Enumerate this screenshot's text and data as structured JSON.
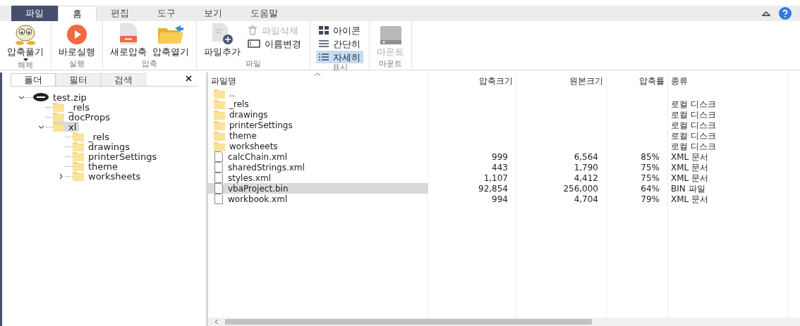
{
  "menu_tabs": [
    {
      "label": "파일",
      "kind": "file",
      "selected": false
    },
    {
      "label": "홈",
      "kind": "tab",
      "selected": true
    },
    {
      "label": "편집",
      "kind": "tab",
      "selected": false
    },
    {
      "label": "도구",
      "kind": "tab",
      "selected": false
    },
    {
      "label": "보기",
      "kind": "tab",
      "selected": false
    },
    {
      "label": "도움말",
      "kind": "tab",
      "selected": false
    }
  ],
  "ribbon": {
    "groups": [
      {
        "label": "해제",
        "items": [
          {
            "label": "압축풀기",
            "kind": "big",
            "dropdown": true,
            "disabled": false
          }
        ]
      },
      {
        "label": "실행",
        "items": [
          {
            "label": "바로실행",
            "kind": "big",
            "disabled": false
          }
        ]
      },
      {
        "label": "압축",
        "items": [
          {
            "label": "새로압축",
            "kind": "big",
            "disabled": false
          },
          {
            "label": "압축열기",
            "kind": "big",
            "disabled": false
          }
        ]
      },
      {
        "label": "파일",
        "items": [
          {
            "label": "파일추가",
            "kind": "big",
            "disabled": false
          },
          {
            "label": "파일삭제",
            "kind": "small",
            "disabled": true
          },
          {
            "label": "이름변경",
            "kind": "small",
            "disabled": false
          }
        ]
      },
      {
        "label": "표시",
        "items": [
          {
            "label": "아이콘",
            "kind": "view",
            "selected": false
          },
          {
            "label": "간단히",
            "kind": "view",
            "selected": false
          },
          {
            "label": "자세히",
            "kind": "view",
            "selected": true
          }
        ]
      },
      {
        "label": "마운트",
        "items": [
          {
            "label": "마운트",
            "kind": "big",
            "disabled": true
          }
        ]
      }
    ]
  },
  "side_tabs": [
    {
      "label": "폴더",
      "selected": true
    },
    {
      "label": "필터",
      "selected": false
    },
    {
      "label": "검색",
      "selected": false
    }
  ],
  "tree": [
    {
      "label": "test.zip",
      "kind": "archive",
      "expanded": true,
      "selected": false,
      "children": [
        {
          "label": "_rels",
          "kind": "folder",
          "selected": false
        },
        {
          "label": "docProps",
          "kind": "folder",
          "selected": false
        },
        {
          "label": "xl",
          "kind": "folder",
          "expanded": true,
          "selected": true,
          "children": [
            {
              "label": "_rels",
              "kind": "folder",
              "selected": false
            },
            {
              "label": "drawings",
              "kind": "folder",
              "selected": false
            },
            {
              "label": "printerSettings",
              "kind": "folder",
              "selected": false
            },
            {
              "label": "theme",
              "kind": "folder",
              "selected": false
            },
            {
              "label": "worksheets",
              "kind": "folder",
              "expanded": false,
              "selected": false
            }
          ]
        }
      ]
    }
  ],
  "table": {
    "columns": [
      "파일명",
      "압축크기",
      "원본크기",
      "압축률",
      "종류"
    ],
    "rows": [
      {
        "kind": "folder",
        "selected": false,
        "cells": [
          "..",
          "",
          "",
          "",
          ""
        ]
      },
      {
        "kind": "folder",
        "selected": false,
        "cells": [
          "_rels",
          "",
          "",
          "",
          "로컬 디스크"
        ]
      },
      {
        "kind": "folder",
        "selected": false,
        "cells": [
          "drawings",
          "",
          "",
          "",
          "로컬 디스크"
        ]
      },
      {
        "kind": "folder",
        "selected": false,
        "cells": [
          "printerSettings",
          "",
          "",
          "",
          "로컬 디스크"
        ]
      },
      {
        "kind": "folder",
        "selected": false,
        "cells": [
          "theme",
          "",
          "",
          "",
          "로컬 디스크"
        ]
      },
      {
        "kind": "folder",
        "selected": false,
        "cells": [
          "worksheets",
          "",
          "",
          "",
          "로컬 디스크"
        ]
      },
      {
        "kind": "file",
        "selected": false,
        "cells": [
          "calcChain.xml",
          "999",
          "6,564",
          "85%",
          "XML 문서"
        ]
      },
      {
        "kind": "file",
        "selected": false,
        "cells": [
          "sharedStrings.xml",
          "443",
          "1,790",
          "75%",
          "XML 문서"
        ]
      },
      {
        "kind": "file",
        "selected": false,
        "cells": [
          "styles.xml",
          "1,107",
          "4,412",
          "75%",
          "XML 문서"
        ]
      },
      {
        "kind": "file",
        "selected": true,
        "cells": [
          "vbaProject.bin",
          "92,854",
          "256,000",
          "64%",
          "BIN 파일"
        ]
      },
      {
        "kind": "file",
        "selected": false,
        "cells": [
          "workbook.xml",
          "994",
          "4,704",
          "79%",
          "XML 문서"
        ]
      }
    ]
  }
}
